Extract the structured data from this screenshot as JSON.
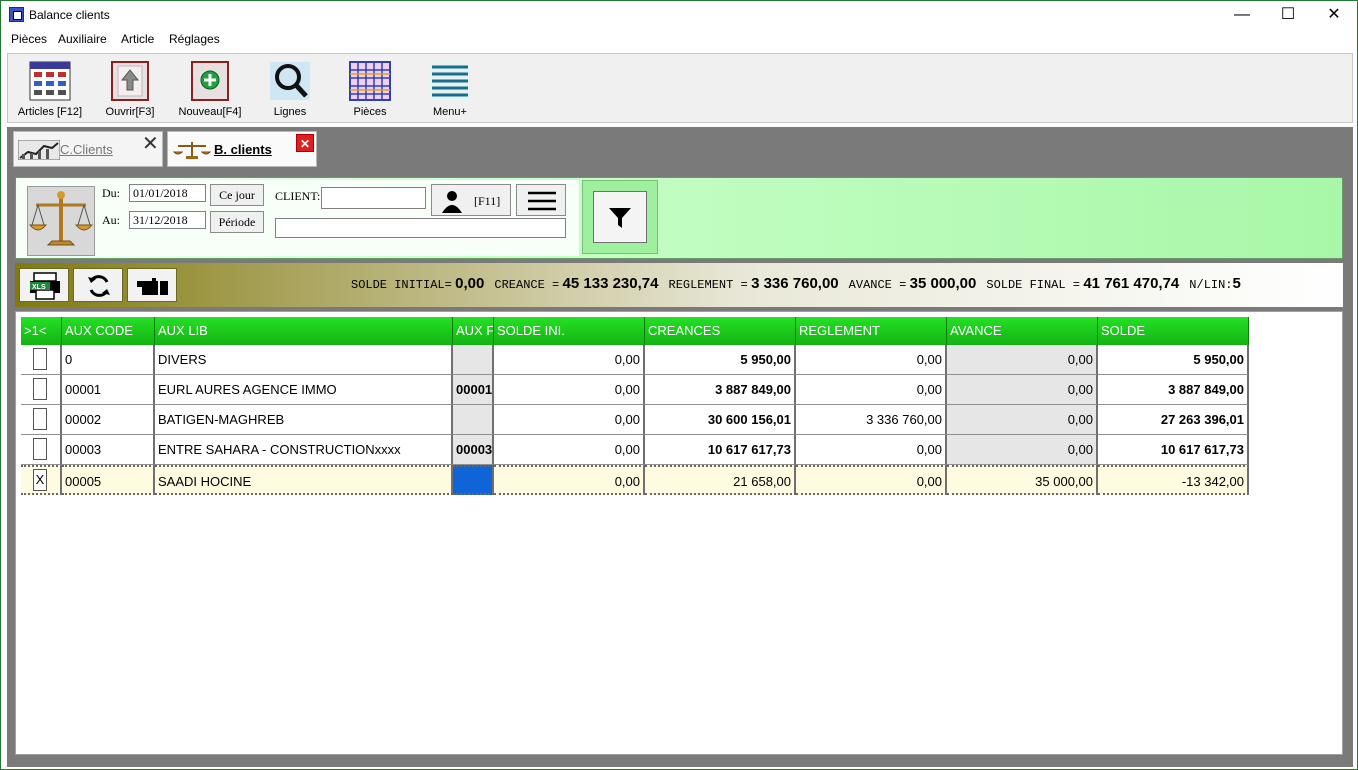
{
  "window": {
    "title": "Balance clients",
    "controls": {
      "minimize": "—",
      "maximize": "☐",
      "close": "✕"
    }
  },
  "menu": [
    "Pièces",
    "Auxiliaire",
    "Article",
    "Réglages"
  ],
  "toolbar": [
    {
      "label": "Articles [F12]",
      "icon": "articles-grid-icon"
    },
    {
      "label": "Ouvrir[F3]",
      "icon": "open-up-arrow-icon"
    },
    {
      "label": "Nouveau[F4]",
      "icon": "new-plus-icon"
    },
    {
      "label": "Lignes",
      "icon": "magnifier-icon"
    },
    {
      "label": "Pièces",
      "icon": "pieces-grid-icon"
    },
    {
      "label": "Menu+",
      "icon": "menu-lines-icon"
    }
  ],
  "tabs": [
    {
      "label": "C.Clients",
      "icon": "chart-icon",
      "close": "✕"
    },
    {
      "label": "B. clients",
      "icon": "scale-icon",
      "close": "✕",
      "active": true
    }
  ],
  "filter": {
    "du_label": "Du:",
    "du_value": "01/01/2018",
    "au_label": "Au:",
    "au_value": "31/12/2018",
    "ce_jour": "Ce jour",
    "periode": "Période",
    "client_label": "CLIENT:",
    "client_value": "",
    "client_name_value": "",
    "f11_label": "[F11]"
  },
  "summary": {
    "solde_initial_label": "SOLDE INITIAL=",
    "solde_initial": "0,00",
    "creance_label": "CREANCE =",
    "creance": "45 133 230,74",
    "reglement_label": "REGLEMENT  =",
    "reglement": "3 336 760,00",
    "avance_label": "AVANCE =",
    "avance": "35 000,00",
    "solde_final_label": "SOLDE FINAL =",
    "solde_final": "41 761 470,74",
    "nlin_label": "N/LIN:",
    "nlin": "5"
  },
  "table": {
    "headers": [
      ">1<",
      "AUX CODE",
      "AUX LIB",
      "AUX F",
      "SOLDE INI.",
      "CREANCES",
      "REGLEMENT",
      "AVANCE",
      "SOLDE"
    ],
    "rows": [
      {
        "check": "",
        "code": "0",
        "lib": "DIVERS",
        "auxf": "",
        "solde_ini": "0,00",
        "creances": "5 950,00",
        "reglement": "0,00",
        "avance": "0,00",
        "solde": "5 950,00"
      },
      {
        "check": "",
        "code": "00001",
        "lib": "EURL AURES AGENCE IMMO",
        "auxf": "00001",
        "solde_ini": "0,00",
        "creances": "3 887 849,00",
        "reglement": "0,00",
        "avance": "0,00",
        "solde": "3 887 849,00"
      },
      {
        "check": "",
        "code": "00002",
        "lib": "BATIGEN-MAGHREB",
        "auxf": "",
        "solde_ini": "0,00",
        "creances": "30 600 156,01",
        "reglement": "3 336 760,00",
        "avance": "0,00",
        "solde": "27 263 396,01"
      },
      {
        "check": "",
        "code": "00003",
        "lib": "ENTRE SAHARA - CONSTRUCTIONxxxx",
        "auxf": "00003",
        "solde_ini": "0,00",
        "creances": "10 617 617,73",
        "reglement": "0,00",
        "avance": "0,00",
        "solde": "10 617 617,73"
      },
      {
        "check": "X",
        "code": "00005",
        "lib": "SAADI HOCINE",
        "auxf": "",
        "solde_ini": "0,00",
        "creances": "21 658,00",
        "reglement": "0,00",
        "avance": "35 000,00",
        "solde": "-13 342,00",
        "selected": true
      }
    ]
  }
}
